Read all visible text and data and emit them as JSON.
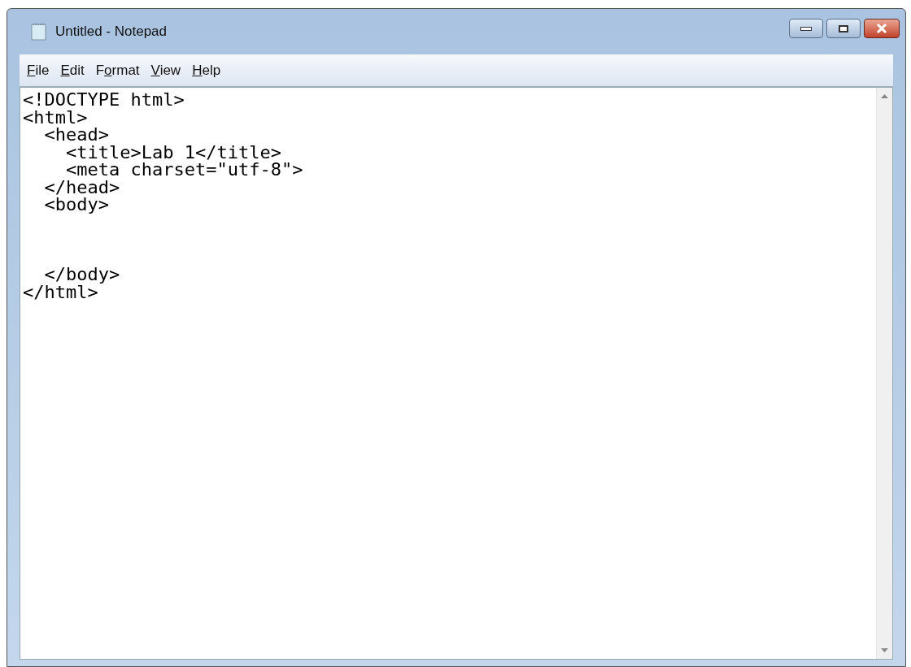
{
  "window": {
    "title": "Untitled - Notepad"
  },
  "menu": [
    {
      "key": "F",
      "post": "ile"
    },
    {
      "key": "E",
      "post": "dit"
    },
    {
      "pre": "F",
      "key": "o",
      "post": "rmat"
    },
    {
      "key": "V",
      "post": "iew"
    },
    {
      "key": "H",
      "post": "elp"
    }
  ],
  "editor": {
    "text": "<!DOCTYPE html>\n<html>\n  <head>\n    <title>Lab 1</title>\n    <meta charset=\"utf-8\">\n  </head>\n  <body>\n\n\n\n  </body>\n</html>"
  }
}
